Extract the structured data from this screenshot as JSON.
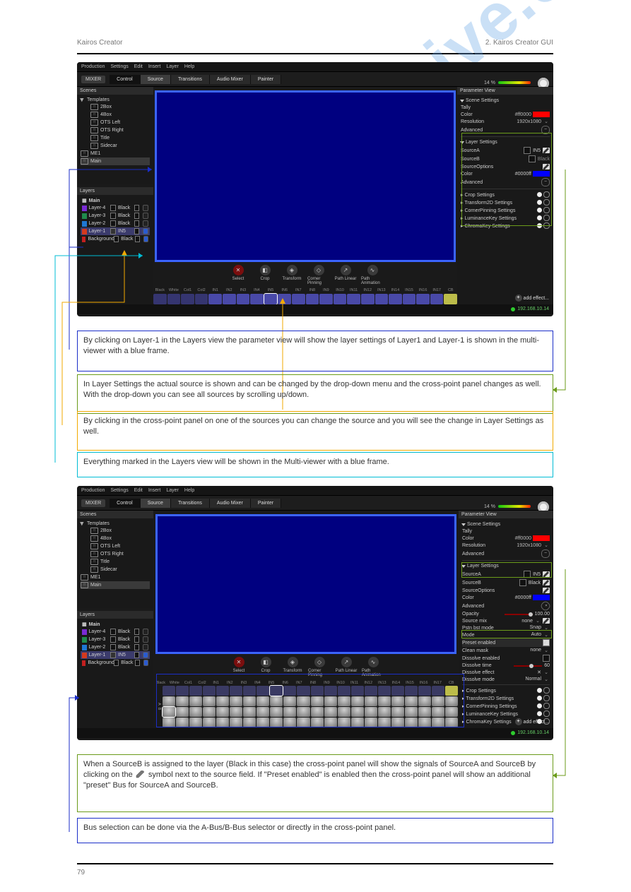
{
  "header": {
    "left": "Kairos Creator",
    "right": "2. Kairos Creator GUI"
  },
  "footer": {
    "left": "79",
    "right": ""
  },
  "watermark": "manualshive.com",
  "menus": [
    "Production",
    "Settings",
    "Edit",
    "Insert",
    "Layer",
    "Help"
  ],
  "mixer": "MIXER",
  "tabs": [
    {
      "label": "Control",
      "active": false,
      "black": true
    },
    {
      "label": "Source",
      "active": true,
      "black": false
    },
    {
      "label": "Transitions",
      "active": false,
      "black": false
    },
    {
      "label": "Audio Mixer",
      "active": false,
      "black": false
    },
    {
      "label": "Painter",
      "active": false,
      "black": false
    }
  ],
  "cpu": {
    "pct": "14 %"
  },
  "scenesTitle": "Scenes",
  "templatesTitle": "Templates",
  "scenes": [
    "2Box",
    "4Box",
    "OTS Left",
    "OTS Right",
    "Title",
    "Sidecar"
  ],
  "me": [
    "ME1",
    "Main"
  ],
  "layersTitle": "Layers",
  "mainLbl": "Main",
  "layers": [
    {
      "name": "Layer-4",
      "sw": "#7a2bd4",
      "src": "Black"
    },
    {
      "name": "Layer-3",
      "sw": "#1f8b4c",
      "src": "Black"
    },
    {
      "name": "Layer-2",
      "sw": "#1f78d4",
      "src": "Black"
    },
    {
      "name": "Layer-1",
      "sw": "#d43a1f",
      "src": "IN5",
      "sel": true,
      "eyeBlue": true
    },
    {
      "name": "Background",
      "sw": "#c21f1f",
      "src": "Black"
    }
  ],
  "tools": [
    {
      "label": "Select",
      "sel": true
    },
    {
      "label": "Crop"
    },
    {
      "label": "Transform"
    },
    {
      "label": "Corner Pinning"
    },
    {
      "label": "Path Linear"
    },
    {
      "label": "Path Animation"
    }
  ],
  "busLabels": [
    "Black",
    "White",
    "Col1",
    "Col2",
    "IN1",
    "IN2",
    "IN3",
    "IN4",
    "IN5",
    "IN6",
    "IN7",
    "IN8",
    "IN9",
    "IN10",
    "IN11",
    "IN12",
    "IN13",
    "IN14",
    "IN15",
    "IN16",
    "IN17",
    "CB"
  ],
  "paramTitle": "Parameter View",
  "sceneSettings": "Scene Settings",
  "tally": "Tally",
  "colorLbl": "Color",
  "colorHex": "#ff0000",
  "resLbl": "Resolution",
  "resVal": "1920x1080",
  "adv": "Advanced",
  "layerSettings": "Layer Settings",
  "srcA": "SourceA",
  "srcAval": "IN5",
  "srcB": "SourceB",
  "srcBval": "Black",
  "srcOpt": "SourceOptions",
  "layerColor": "#0000ff",
  "effects": [
    "Crop Settings",
    "Transform2D Settings",
    "CornerPinning Settings",
    "LuminanceKey Settings",
    "ChromaKey Settings"
  ],
  "addEffect": "add effect...",
  "ip": "192.168.10.14",
  "advPanel": {
    "opacity": {
      "label": "Opacity",
      "val": "100.00"
    },
    "srcMix": {
      "label": "Source mix",
      "val": "none"
    },
    "patBst": {
      "label": "Pstn bst mode",
      "val": "Snap"
    },
    "mode": {
      "label": "Mode",
      "val": "Auto"
    },
    "preset": {
      "label": "Preset enabled"
    },
    "clean": {
      "label": "Clean mask",
      "val": "none"
    },
    "dissEn": {
      "label": "Dissolve enabled"
    },
    "dissTime": {
      "label": "Dissolve time",
      "val": "60"
    },
    "dissEff": {
      "label": "Dissolve effect"
    },
    "dissMode": {
      "label": "Dissolve mode",
      "val": "Normal"
    }
  },
  "annotations": {
    "a1": "By clicking on Layer-1 in the Layers view the parameter view will show the layer settings of Layer1 and Layer-1 is shown in the multi-viewer with a blue frame.",
    "a2": "In Layer Settings the actual source is shown and can be changed by the drop-down menu and the cross-point panel changes as well. With the drop-down you can see all sources by scrolling up/down.",
    "a3": "By clicking in the cross-point panel on one of the sources you can change the source and you will see the change in Layer Settings as well.",
    "a4": "Everything marked in the Layers view will be shown in the Multi-viewer with a blue frame.",
    "b1_pre": "When a SourceB is assigned to the layer (Black in this case) the cross-point panel will show the signals of SourceA and SourceB by clicking on the ",
    "b1_post": " symbol next to the source field. If \"Preset enabled\" is enabled then the cross-point panel will show an additional \"preset\" Bus for SourceA and SourceB.",
    "b2": "Bus selection can be done via the A-Bus/B-Bus selector or directly in the cross-point panel."
  }
}
